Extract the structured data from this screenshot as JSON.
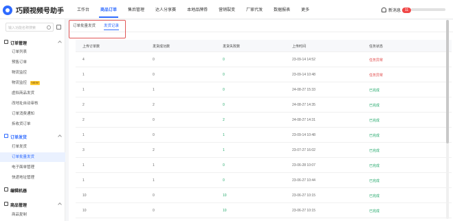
{
  "app": {
    "title": "巧顾视频号助手"
  },
  "nav": [
    "工作台",
    "商品订单",
    "售后管理",
    "达人分享赛",
    "本地品牌券",
    "营销裂变",
    "厂家代发",
    "数据报表",
    "更多"
  ],
  "header": {
    "message_label": "新消息",
    "message_count": "11"
  },
  "sidebar": {
    "search_placeholder": "输入功能名称搜索",
    "groups": [
      {
        "label": "订单管理"
      },
      {
        "label": "订单发货"
      },
      {
        "label": "编辑机器"
      },
      {
        "label": "商品管理"
      }
    ],
    "order_items": [
      "订单列表",
      "预售订单",
      "物流监控",
      "物流监控",
      "虚拟商品发货",
      "改地址自动审核",
      "订单消费通知",
      "拆收货订单"
    ],
    "new_tag": "NEW",
    "ship_items": [
      "打单发货",
      "订单批量发货",
      "电子面单管理",
      "快递地址管理"
    ],
    "product_items": [
      "商品复制"
    ]
  },
  "tabs": [
    {
      "label": "订单批量发货"
    },
    {
      "label": "发货记录"
    }
  ],
  "table": {
    "columns": [
      "上传订单数",
      "发货成功数",
      "发货失败数",
      "上传时间",
      "任务状态"
    ],
    "rows": [
      [
        "4",
        "0",
        "0",
        "23-09-14 14:52",
        "任务异常"
      ],
      [
        "1",
        "0",
        "0",
        "23-09-14 10:48",
        "任务异常"
      ],
      [
        "1",
        "1",
        "0",
        "24-08-27 15:33",
        "已完成"
      ],
      [
        "2",
        "2",
        "0",
        "24-08-27 14:35",
        "已完成"
      ],
      [
        "2",
        "0",
        "2",
        "24-08-27 14:31",
        "已完成"
      ],
      [
        "1",
        "0",
        "1",
        "23-09-14 10:48",
        "已完成"
      ],
      [
        "3",
        "2",
        "1",
        "23-07-27 16:02",
        "已完成"
      ],
      [
        "1",
        "1",
        "0",
        "23-06-28 10:07",
        "已完成"
      ],
      [
        "1",
        "1",
        "0",
        "23-06-27 10:44",
        "已完成"
      ],
      [
        "10",
        "0",
        "10",
        "23-06-27 10:15",
        "已完成"
      ],
      [
        "10",
        "0",
        "10",
        "23-06-27 10:15",
        "已完成"
      ]
    ]
  },
  "colors": {
    "accent": "#2f6bff",
    "success": "#21a86a",
    "danger": "#e04545"
  }
}
